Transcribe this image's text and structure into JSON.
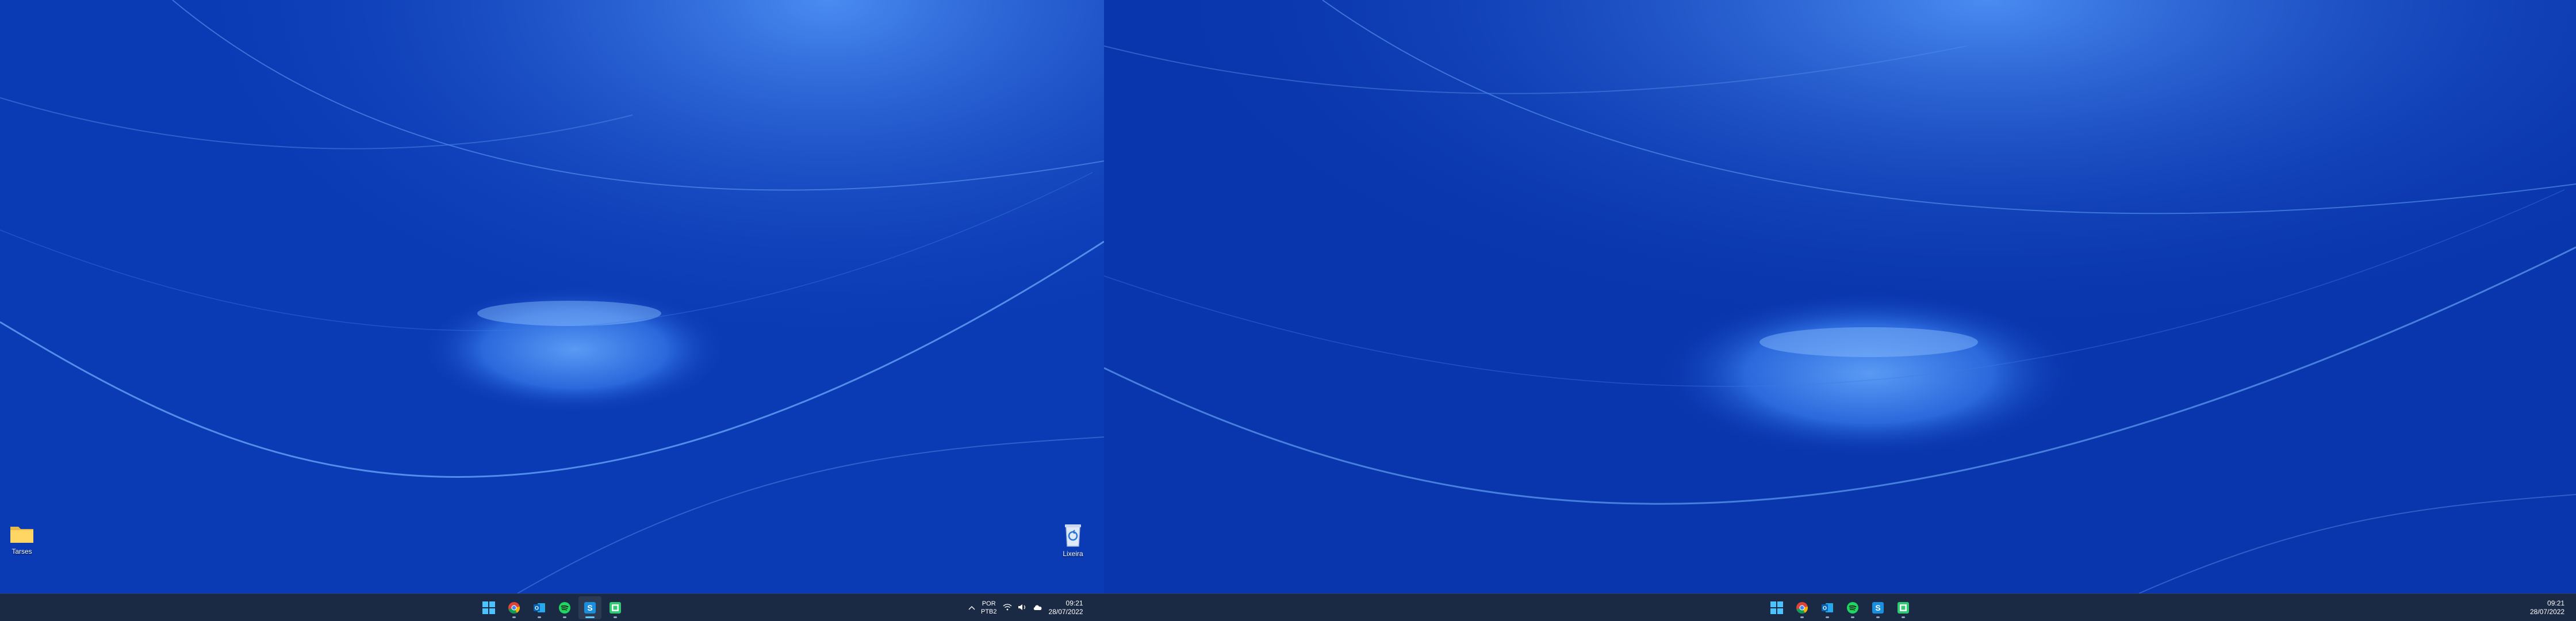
{
  "desktop": {
    "icons": [
      {
        "label": "Tarses",
        "icon": "folder-icon"
      },
      {
        "label": "Lixeira",
        "icon": "recycle-bin-icon"
      }
    ]
  },
  "taskbar": {
    "apps": [
      {
        "name": "Start",
        "icon": "windows-start-icon"
      },
      {
        "name": "Google Chrome",
        "icon": "chrome-icon"
      },
      {
        "name": "Outlook",
        "icon": "outlook-icon"
      },
      {
        "name": "Spotify",
        "icon": "spotify-icon"
      },
      {
        "name": "Snipping/Scan App",
        "icon": "app-s-icon",
        "active": true
      },
      {
        "name": "Green App",
        "icon": "app-green-square-icon"
      }
    ],
    "tray": {
      "language_line1": "POR",
      "language_line2": "PTB2",
      "time": "09:21",
      "date": "28/07/2022"
    }
  },
  "colors": {
    "wallpaper_dark": "#0b3ab5",
    "wallpaper_light": "#4b8cf0",
    "taskbar_bg": "#1b2a44",
    "accent": "#60cdff"
  }
}
